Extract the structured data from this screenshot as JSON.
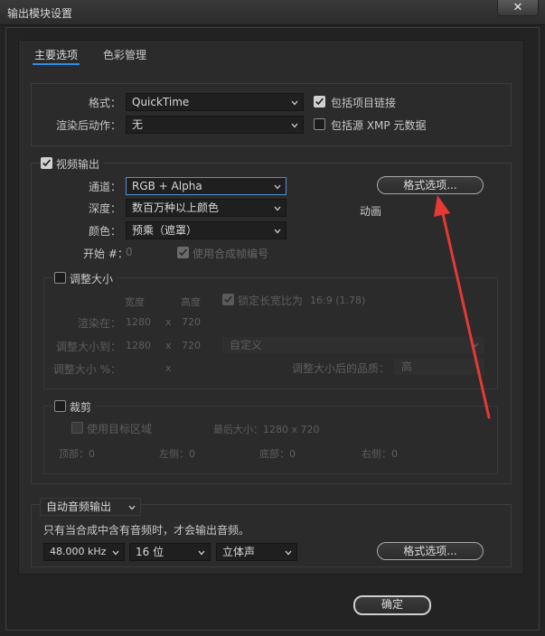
{
  "window": {
    "title": "输出模块设置",
    "close": "✕"
  },
  "tabs": [
    {
      "label": "主要选项"
    },
    {
      "label": "色彩管理"
    }
  ],
  "format_section": {
    "format_label": "格式：",
    "format_value": "QuickTime",
    "post_render_label": "渲染后动作：",
    "post_render_value": "无",
    "include_project_link": "包括项目链接",
    "include_xmp": "包括源 XMP 元数据"
  },
  "video_output": {
    "header": "视频输出",
    "channels_label": "通道：",
    "channels_value": "RGB + Alpha",
    "depth_label": "深度：",
    "depth_value": "数百万种以上颜色",
    "color_label": "颜色：",
    "color_value": "预乘（遮罩）",
    "start_label": "开始 #：",
    "start_value": "0",
    "use_comp_frame": "使用合成帧编号",
    "format_options_button": "格式选项...",
    "format_info": "动画"
  },
  "resize": {
    "header": "调整大小",
    "col_width": "宽度",
    "col_height": "高度",
    "lock_aspect": "锁定长宽比为",
    "aspect_value": "16:9 (1.78)",
    "render_at_label": "渲染在：",
    "render_w": "1280",
    "render_h": "720",
    "resize_to_label": "调整大小到：",
    "resize_w": "1280",
    "resize_h": "720",
    "preset": "自定义",
    "percent_label": "调整大小 %：",
    "x": "x",
    "quality_label": "调整大小后的品质：",
    "quality_value": "高"
  },
  "crop": {
    "header": "裁剪",
    "use_roi": "使用目标区域",
    "final_size": "最后大小：1280 x 720",
    "top": "顶部：0",
    "left": "左侧：0",
    "bottom": "底部：0",
    "right": "右侧：0"
  },
  "audio": {
    "mode": "自动音频输出",
    "note": "只有当合成中含有音频时，才会输出音频。",
    "rate": "48.000 kHz",
    "bits": "16 位",
    "channels": "立体声",
    "format_options_button": "格式选项..."
  },
  "ok_button": "确定",
  "colors": {
    "accent": "#2d8ceb",
    "arrow": "#e53935"
  }
}
